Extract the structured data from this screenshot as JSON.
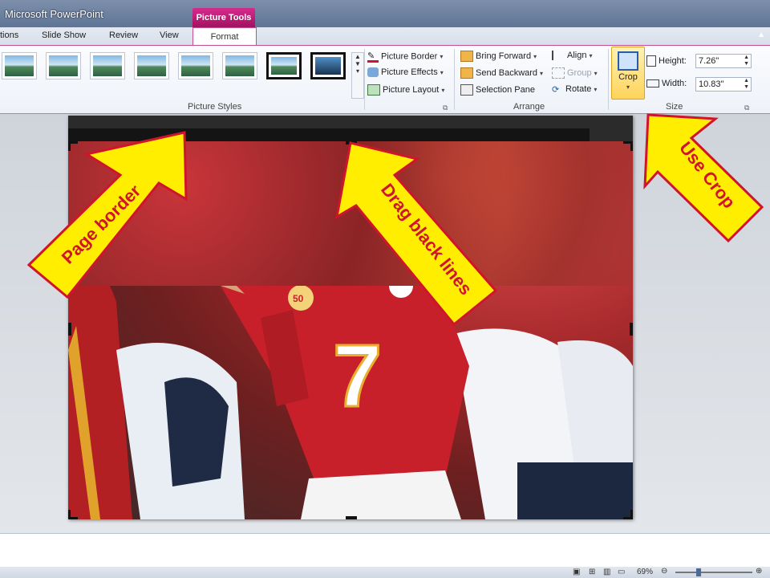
{
  "window": {
    "title": "Microsoft PowerPoint",
    "tool_tab_header": "Picture Tools"
  },
  "tabs": [
    {
      "label": "tions"
    },
    {
      "label": "Slide Show"
    },
    {
      "label": "Review"
    },
    {
      "label": "View"
    }
  ],
  "active_tab": {
    "label": "Format"
  },
  "ribbon": {
    "picture_styles": {
      "group_label": "Picture Styles",
      "gallery_count_visible": 8
    },
    "picture_cmds": {
      "border": "Picture Border",
      "effects": "Picture Effects",
      "layout": "Picture Layout"
    },
    "arrange": {
      "group_label": "Arrange",
      "bring_forward": "Bring Forward",
      "send_backward": "Send Backward",
      "selection_pane": "Selection Pane",
      "align": "Align",
      "group": "Group",
      "rotate": "Rotate"
    },
    "size": {
      "group_label": "Size",
      "crop": "Crop",
      "height_label": "Height:",
      "height_value": "7.26\"",
      "width_label": "Width:",
      "width_value": "10.83\""
    }
  },
  "annotations": {
    "page_border": "Page border",
    "drag_lines": "Drag black lines",
    "use_crop": "Use Crop"
  },
  "photo": {
    "jersey_number": "7",
    "patch_text": "50"
  },
  "status": {
    "zoom": "69%"
  },
  "colors": {
    "arrow_fill": "#ffee00",
    "arrow_stroke": "#d0142c",
    "accent": "#c44d93"
  }
}
